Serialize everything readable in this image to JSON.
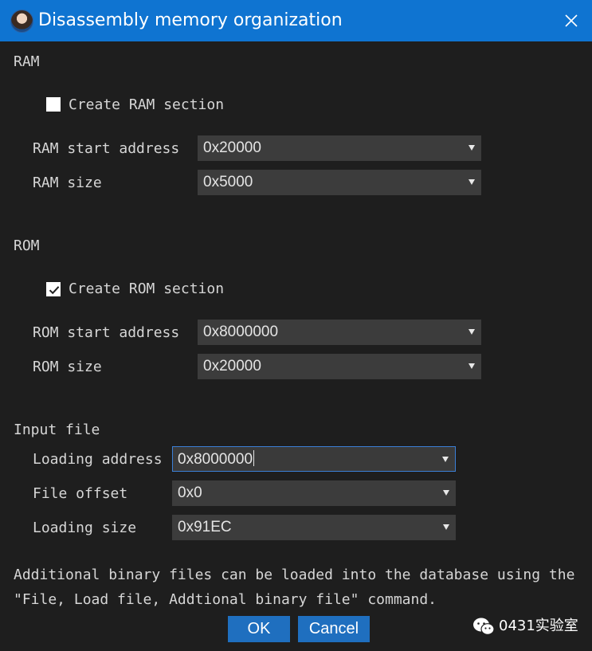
{
  "window": {
    "title": "Disassembly memory organization",
    "icon": "app-portrait-icon",
    "close_icon": "close-icon"
  },
  "ram": {
    "section_label": "RAM",
    "create_label": "Create RAM section",
    "create_checked": false,
    "start_label": "RAM start address",
    "start_value": "0x20000",
    "size_label": "RAM size",
    "size_value": "0x5000"
  },
  "rom": {
    "section_label": "ROM",
    "create_label": "Create ROM section",
    "create_checked": true,
    "start_label": "ROM start address",
    "start_value": "0x8000000",
    "size_label": "ROM size",
    "size_value": "0x20000"
  },
  "input_file": {
    "section_label": "Input file",
    "loading_address_label": "Loading address",
    "loading_address_value": "0x8000000",
    "file_offset_label": "File offset",
    "file_offset_value": "0x0",
    "loading_size_label": "Loading size",
    "loading_size_value": "0x91EC"
  },
  "note": {
    "line1": "Additional binary files can be loaded into the database using the",
    "line2": "\"File, Load file, Addtional binary file\" command."
  },
  "buttons": {
    "ok": "OK",
    "cancel": "Cancel"
  },
  "watermark": {
    "text": "0431实验室",
    "icon": "wechat-icon"
  },
  "colors": {
    "titlebar": "#0f74d1",
    "background": "#1e1e1e",
    "combo": "#3c3c3c",
    "button": "#1f6fbf",
    "focus_border": "#3b7fd6"
  }
}
